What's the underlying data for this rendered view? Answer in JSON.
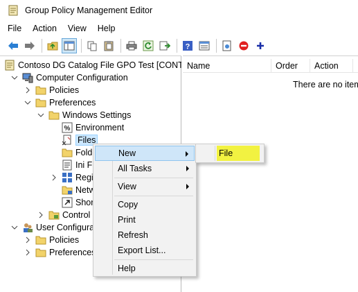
{
  "window": {
    "title": "Group Policy Management Editor"
  },
  "menubar": {
    "items": [
      "File",
      "Action",
      "View",
      "Help"
    ]
  },
  "toolbar": {
    "icons": [
      "back-arrow-icon",
      "forward-arrow-icon",
      "up-folder-icon",
      "show-hide-tree-icon",
      "copy-icon",
      "paste-icon",
      "print-icon",
      "refresh-icon",
      "export-list-icon",
      "help-icon",
      "properties-icon",
      "new-item-icon",
      "block-icon",
      "add-icon"
    ]
  },
  "tree": {
    "root": "Contoso DG Catalog File GPO Test [CONTC",
    "computer_configuration": "Computer Configuration",
    "policies": "Policies",
    "preferences": "Preferences",
    "windows_settings": "Windows Settings",
    "environment": "Environment",
    "files": "Files",
    "folders": "Folde",
    "ini_files": "Ini Fi",
    "registry": "Regis",
    "network_shares": "Netw",
    "shortcuts": "Shor",
    "control_panel": "Control",
    "user_configuration": "User Configurati",
    "user_policies": "Policies",
    "user_preferences": "Preferences"
  },
  "list": {
    "columns": [
      "Name",
      "Order",
      "Action"
    ],
    "empty_message": "There are no items"
  },
  "context_menu": {
    "new": "New",
    "all_tasks": "All Tasks",
    "view": "View",
    "copy": "Copy",
    "print": "Print",
    "refresh": "Refresh",
    "export_list": "Export List...",
    "help": "Help"
  },
  "submenu": {
    "file": "File",
    "highlight_color": "#f2f241"
  }
}
